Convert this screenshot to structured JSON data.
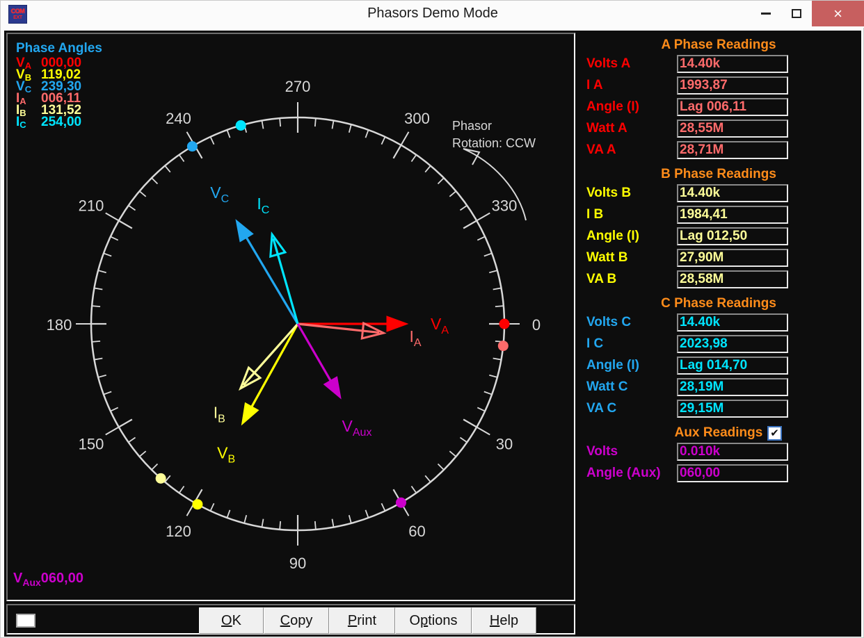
{
  "window": {
    "title": "Phasors Demo Mode",
    "icon_line1": "COM",
    "icon_line2": "EXT",
    "minimize_label": "",
    "maximize_label": "",
    "close_label": "×"
  },
  "phase_angles": {
    "title": "Phase Angles",
    "rows": [
      {
        "symbol": "V",
        "sub": "A",
        "value": "000,00",
        "color": "#ff0000"
      },
      {
        "symbol": "V",
        "sub": "B",
        "value": "119,02",
        "color": "#ffff00"
      },
      {
        "symbol": "V",
        "sub": "C",
        "value": "239,30",
        "color": "#22a7f0"
      },
      {
        "symbol": "I",
        "sub": "A",
        "value": "006,11",
        "color": "#ff6b6b"
      },
      {
        "symbol": "I",
        "sub": "B",
        "value": "131,52",
        "color": "#ffff99"
      },
      {
        "symbol": "I",
        "sub": "C",
        "value": "254,00",
        "color": "#00e5ff"
      }
    ]
  },
  "rotation_note": {
    "line1": "Phasor",
    "line2": "Rotation: CCW"
  },
  "aux_footer": {
    "symbol": "V",
    "sub": "Aux",
    "value": "060,00",
    "color": "#cc00cc"
  },
  "plot": {
    "scale_labels": [
      "0",
      "30",
      "60",
      "90",
      "120",
      "150",
      "180",
      "210",
      "240",
      "270",
      "300",
      "330"
    ],
    "scale_color": "#d8d8d8",
    "phasors": [
      {
        "name": "V_A",
        "label": "V",
        "sub": "A",
        "angle": 0.0,
        "length": 152,
        "color": "#ff0000",
        "filled": true,
        "dot_color": "#ff0000"
      },
      {
        "name": "V_B",
        "label": "V",
        "sub": "B",
        "angle": 119.02,
        "length": 160,
        "color": "#ffff00",
        "filled": true,
        "dot_color": "#ffff00"
      },
      {
        "name": "V_C",
        "label": "V",
        "sub": "C",
        "angle": 239.3,
        "length": 168,
        "color": "#22a7f0",
        "filled": true,
        "dot_color": "#22a7f0"
      },
      {
        "name": "I_A",
        "label": "I",
        "sub": "A",
        "angle": 6.11,
        "length": 118,
        "color": "#ff6b6b",
        "filled": false,
        "dot_color": "#ff6b6b"
      },
      {
        "name": "I_B",
        "label": "I",
        "sub": "B",
        "angle": 131.52,
        "length": 118,
        "color": "#ffff99",
        "filled": false,
        "dot_color": "#ffff99"
      },
      {
        "name": "I_C",
        "label": "I",
        "sub": "C",
        "angle": 254.0,
        "length": 128,
        "color": "#00e5ff",
        "filled": false,
        "dot_color": "#00e5ff"
      },
      {
        "name": "V_Aux",
        "label": "V",
        "sub": "Aux",
        "angle": 60.0,
        "length": 118,
        "color": "#cc00cc",
        "filled": true,
        "dot_color": "#cc00cc"
      }
    ]
  },
  "readings": {
    "sections": [
      {
        "title": "A Phase Readings",
        "label_color": "#ff0000",
        "value_color": "#ff6b6b",
        "rows": [
          {
            "label": "Volts A",
            "value": "14.40k"
          },
          {
            "label": "I A",
            "value": "1993,87"
          },
          {
            "label": "Angle (I)",
            "value": "Lag 006,11"
          },
          {
            "label": "Watt A",
            "value": "28,55M"
          },
          {
            "label": "VA A",
            "value": "28,71M"
          }
        ]
      },
      {
        "title": "B Phase Readings",
        "label_color": "#ffff00",
        "value_color": "#ffff99",
        "rows": [
          {
            "label": "Volts B",
            "value": "14.40k"
          },
          {
            "label": "I B",
            "value": "1984,41"
          },
          {
            "label": "Angle (I)",
            "value": "Lag 012,50"
          },
          {
            "label": "Watt B",
            "value": "27,90M"
          },
          {
            "label": "VA B",
            "value": "28,58M"
          }
        ]
      },
      {
        "title": "C Phase Readings",
        "label_color": "#22a7f0",
        "value_color": "#00e5ff",
        "rows": [
          {
            "label": "Volts C",
            "value": "14.40k"
          },
          {
            "label": "I C",
            "value": "2023,98"
          },
          {
            "label": "Angle (I)",
            "value": "Lag 014,70"
          },
          {
            "label": "Watt C",
            "value": "28,19M"
          },
          {
            "label": "VA C",
            "value": "29,15M"
          }
        ]
      },
      {
        "title": "Aux Readings",
        "label_color": "#cc00cc",
        "value_color": "#cc00cc",
        "checkbox_checked": true,
        "checkbox_glyph": "✔",
        "rows": [
          {
            "label": "Volts",
            "value": "0.010k"
          },
          {
            "label": "Angle (Aux)",
            "value": "060,00"
          }
        ]
      }
    ]
  },
  "buttons": [
    {
      "id": "ok",
      "accel": "O",
      "rest": "K"
    },
    {
      "id": "copy",
      "accel": "C",
      "rest": "opy"
    },
    {
      "id": "print",
      "accel": "P",
      "rest": "rint"
    },
    {
      "id": "options",
      "pre": "O",
      "accel": "p",
      "rest": "tions"
    },
    {
      "id": "help",
      "accel": "H",
      "rest": "elp"
    }
  ]
}
